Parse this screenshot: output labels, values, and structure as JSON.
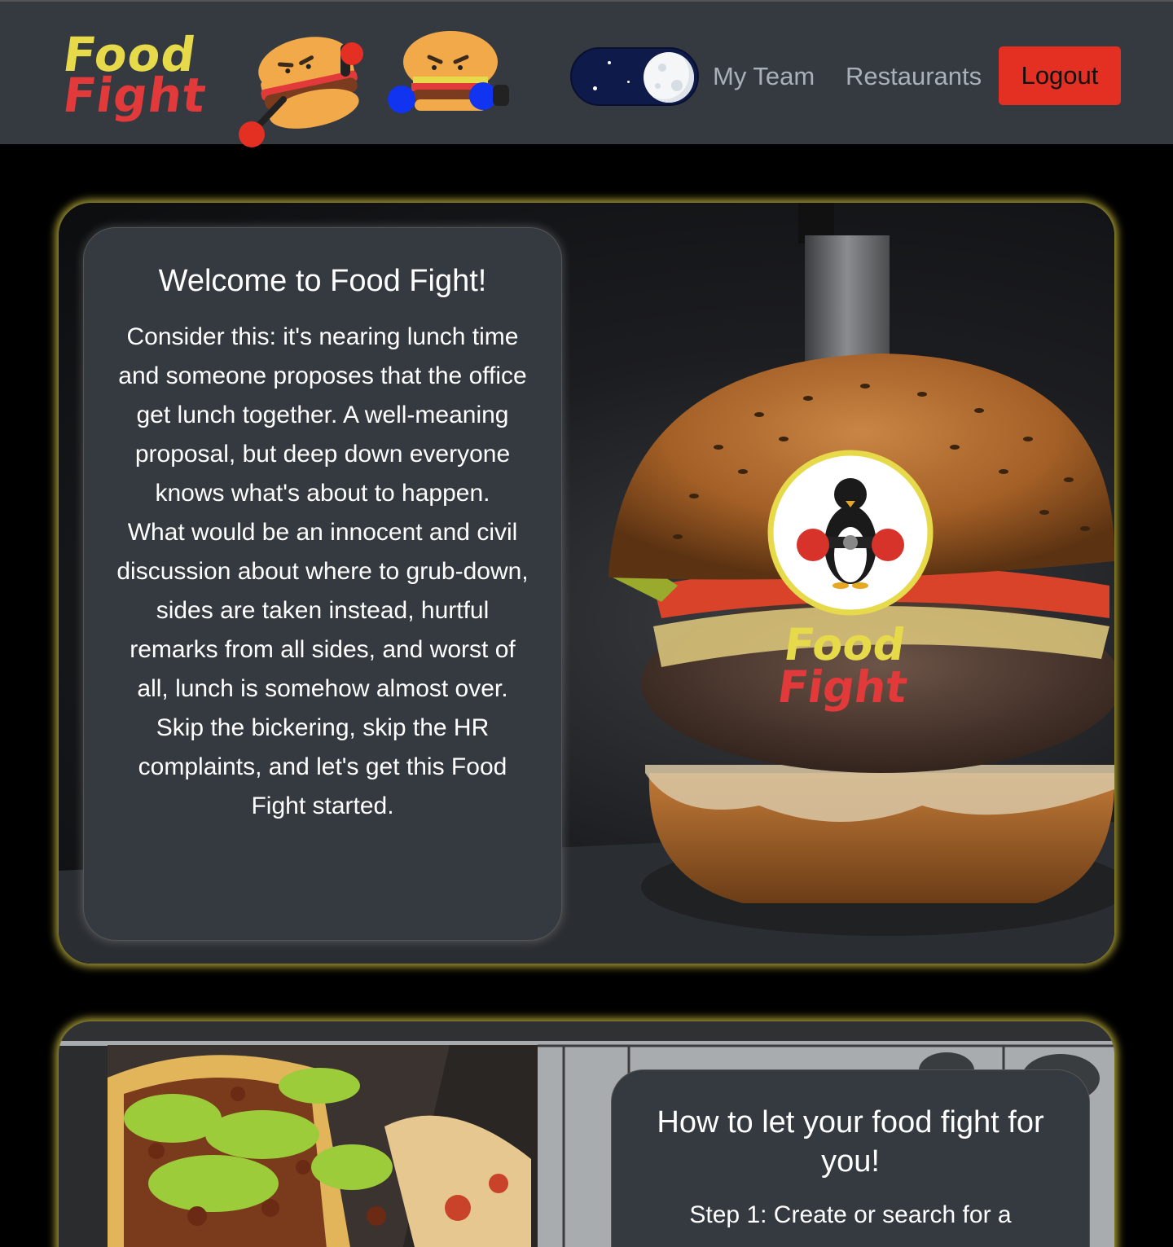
{
  "brand": {
    "word_top": "Food",
    "word_bottom": "Fight",
    "colors": {
      "yellow": "#e6d94a",
      "red": "#e23a3a"
    }
  },
  "nav": {
    "theme_toggle": {
      "state": "dark",
      "icon": "moon-icon"
    },
    "links": [
      {
        "label": "My Team"
      },
      {
        "label": "Restaurants"
      }
    ],
    "logout_label": "Logout",
    "logout_color": "#e42f23"
  },
  "hero": {
    "title": "Welcome to Food Fight!",
    "paragraphs": [
      "Consider this: it's nearing lunch time and someone proposes that the office get lunch together. A well-meaning proposal, but deep down everyone knows what's about to happen.",
      "What would be an innocent and civil discussion about where to grub-down, sides are taken instead, hurtful remarks from all sides, and worst of all, lunch is somehow almost over.",
      "Skip the bickering, skip the HR complaints, and let's get this Food Fight started."
    ],
    "image_logo": {
      "word_top": "Food",
      "word_bottom": "Fight",
      "icon": "boxing-penguin-icon"
    },
    "glow_color": "#dccd46"
  },
  "howto": {
    "title": "How to let your food fight for you!",
    "step1": "Step 1: Create or search for a"
  }
}
